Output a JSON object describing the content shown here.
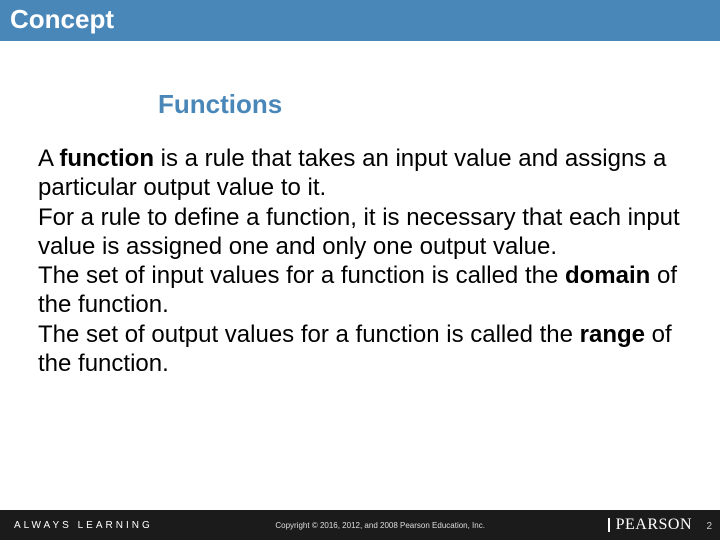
{
  "header": {
    "title": "Concept"
  },
  "content": {
    "subtitle": "Functions",
    "p1a": "A ",
    "p1b": "function",
    "p1c": " is a rule that takes an input value and assigns a particular output value to it.",
    "p2": "For a rule to define a function, it is necessary that each input value is assigned one and only one output value.",
    "p3a": "The set of input values for a function is called the ",
    "p3b": "domain",
    "p3c": " of the function.",
    "p4a": "The set of output values for a function is called the ",
    "p4b": "range",
    "p4c": " of the function."
  },
  "footer": {
    "left": "ALWAYS LEARNING",
    "center": "Copyright © 2016, 2012, and 2008 Pearson Education, Inc.",
    "brand": "PEARSON",
    "page": "2"
  }
}
